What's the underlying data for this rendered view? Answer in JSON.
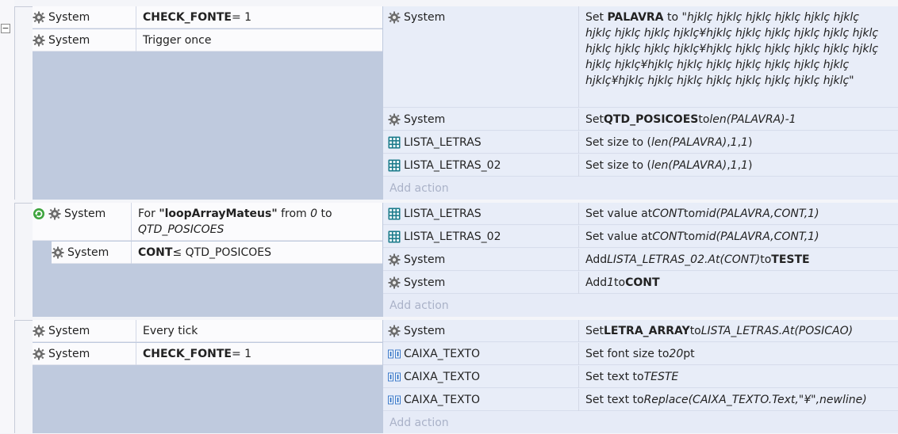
{
  "ui": {
    "add_action": "Add action",
    "collapse_symbol": "−"
  },
  "events": [
    {
      "conditions": [
        {
          "object": "System",
          "parts": [
            {
              "t": "CHECK_FONTE",
              "s": "b"
            },
            {
              "t": " = 1",
              "s": ""
            }
          ]
        },
        {
          "object": "System",
          "parts": [
            {
              "t": "Trigger once",
              "s": ""
            }
          ]
        }
      ],
      "actions": [
        {
          "object": "System",
          "icon": "gear-icon",
          "parts": [
            {
              "t": "Set ",
              "s": ""
            },
            {
              "t": "PALAVRA",
              "s": "b"
            },
            {
              "t": " to ",
              "s": ""
            },
            {
              "t": "\"hjklç hjklç hjklç hjklç hjklç hjklç hjklç hjklç hjklç hjklç¥hjklç hjklç hjklç hjklç hjklç hjklç hjklç hjklç hjklç hjklç¥hjklç hjklç hjklç hjklç hjklç hjklç hjklç hjklç¥hjklç hjklç hjklç hjklç hjklç hjklç hjklç hjklç¥hjklç hjklç hjklç hjklç hjklç hjklç hjklç hjklç\"",
              "s": "i"
            }
          ]
        },
        {
          "object": "System",
          "icon": "gear-icon",
          "parts": [
            {
              "t": "Set ",
              "s": ""
            },
            {
              "t": "QTD_POSICOES",
              "s": "b"
            },
            {
              "t": " to ",
              "s": ""
            },
            {
              "t": "len(PALAVRA)-1",
              "s": "i"
            }
          ]
        },
        {
          "object": "LISTA_LETRAS",
          "icon": "array-grid-icon",
          "parts": [
            {
              "t": "Set size to (",
              "s": ""
            },
            {
              "t": "len(PALAVRA)",
              "s": "i"
            },
            {
              "t": " , ",
              "s": ""
            },
            {
              "t": "1",
              "s": "i"
            },
            {
              "t": ", ",
              "s": ""
            },
            {
              "t": "1",
              "s": "i"
            },
            {
              "t": ")",
              "s": ""
            }
          ]
        },
        {
          "object": "LISTA_LETRAS_02",
          "icon": "array-grid-icon",
          "parts": [
            {
              "t": "Set size to (",
              "s": ""
            },
            {
              "t": "len(PALAVRA)",
              "s": "i"
            },
            {
              "t": " , ",
              "s": ""
            },
            {
              "t": "1",
              "s": "i"
            },
            {
              "t": ", ",
              "s": ""
            },
            {
              "t": "1",
              "s": "i"
            },
            {
              "t": ")",
              "s": ""
            }
          ]
        }
      ]
    },
    {
      "conditions": [
        {
          "object": "System",
          "loop": true,
          "parts": [
            {
              "t": "For ",
              "s": ""
            },
            {
              "t": "\"loopArrayMateus\"",
              "s": "b"
            },
            {
              "t": " from ",
              "s": ""
            },
            {
              "t": "0",
              "s": "i"
            },
            {
              "t": " to ",
              "s": ""
            },
            {
              "t": "QTD_POSICOES",
              "s": "i"
            }
          ]
        },
        {
          "object": "System",
          "parts": [
            {
              "t": "CONT",
              "s": "b"
            },
            {
              "t": " ≤ QTD_POSICOES",
              "s": ""
            }
          ]
        }
      ],
      "actions": [
        {
          "object": "LISTA_LETRAS",
          "icon": "array-grid-icon",
          "parts": [
            {
              "t": "Set value at ",
              "s": ""
            },
            {
              "t": "CONT",
              "s": "i"
            },
            {
              "t": " to ",
              "s": ""
            },
            {
              "t": "mid(PALAVRA,CONT,1)",
              "s": "i"
            }
          ]
        },
        {
          "object": "LISTA_LETRAS_02",
          "icon": "array-grid-icon",
          "parts": [
            {
              "t": "Set value at ",
              "s": ""
            },
            {
              "t": "CONT",
              "s": "i"
            },
            {
              "t": " to ",
              "s": ""
            },
            {
              "t": "mid(PALAVRA,CONT,1)",
              "s": "i"
            }
          ]
        },
        {
          "object": "System",
          "icon": "gear-icon",
          "parts": [
            {
              "t": "Add ",
              "s": ""
            },
            {
              "t": "LISTA_LETRAS_02.At(CONT)",
              "s": "i"
            },
            {
              "t": "  to ",
              "s": ""
            },
            {
              "t": "TESTE",
              "s": "b"
            }
          ]
        },
        {
          "object": "System",
          "icon": "gear-icon",
          "parts": [
            {
              "t": "Add ",
              "s": ""
            },
            {
              "t": "1",
              "s": "i"
            },
            {
              "t": " to ",
              "s": ""
            },
            {
              "t": "CONT",
              "s": "b"
            }
          ]
        }
      ]
    },
    {
      "conditions": [
        {
          "object": "System",
          "parts": [
            {
              "t": "Every tick",
              "s": ""
            }
          ]
        },
        {
          "object": "System",
          "parts": [
            {
              "t": "CHECK_FONTE",
              "s": "b"
            },
            {
              "t": " = 1",
              "s": ""
            }
          ]
        }
      ],
      "actions": [
        {
          "object": "System",
          "icon": "gear-icon",
          "parts": [
            {
              "t": "Set ",
              "s": ""
            },
            {
              "t": "LETRA_ARRAY",
              "s": "b"
            },
            {
              "t": " to ",
              "s": ""
            },
            {
              "t": "LISTA_LETRAS.At(POSICAO)",
              "s": "i"
            }
          ]
        },
        {
          "object": "CAIXA_TEXTO",
          "icon": "text-box-icon",
          "parts": [
            {
              "t": "Set font size to ",
              "s": ""
            },
            {
              "t": "20",
              "s": "i"
            },
            {
              "t": " pt",
              "s": ""
            }
          ]
        },
        {
          "object": "CAIXA_TEXTO",
          "icon": "text-box-icon",
          "parts": [
            {
              "t": "Set text to ",
              "s": ""
            },
            {
              "t": "TESTE",
              "s": "i"
            }
          ]
        },
        {
          "object": "CAIXA_TEXTO",
          "icon": "text-box-icon",
          "parts": [
            {
              "t": "Set text to ",
              "s": ""
            },
            {
              "t": "Replace(CAIXA_TEXTO.Text,\"¥\",newline)",
              "s": "i"
            }
          ]
        }
      ]
    }
  ]
}
